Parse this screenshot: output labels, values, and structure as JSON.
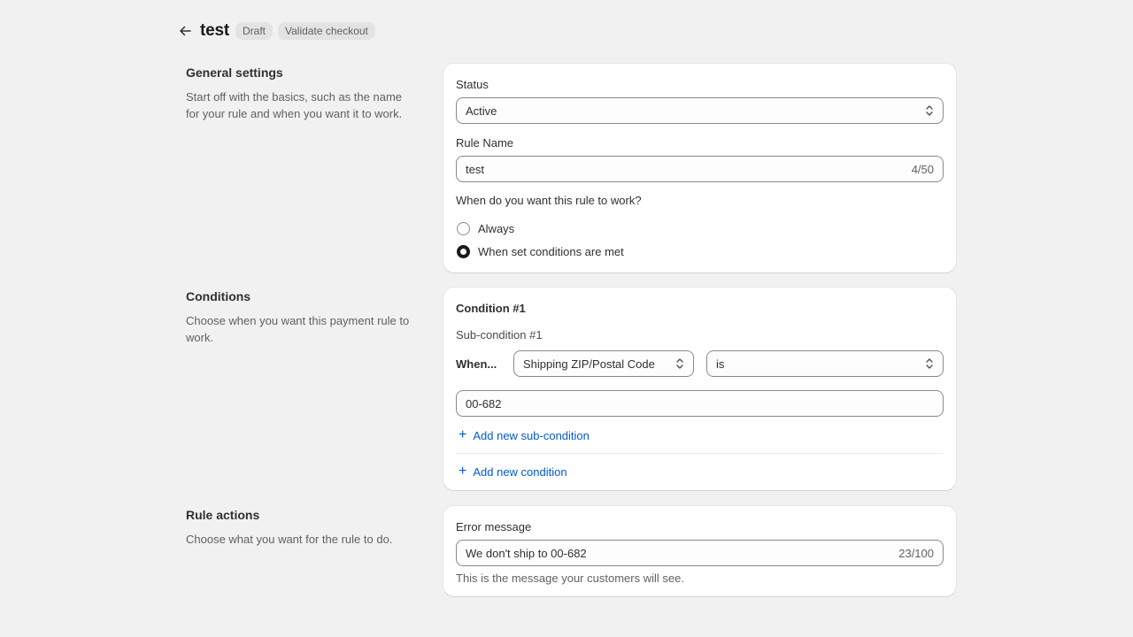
{
  "header": {
    "back_icon": "arrow-left-icon",
    "title": "test",
    "badges": [
      "Draft",
      "Validate checkout"
    ]
  },
  "general": {
    "title": "General settings",
    "description": "Start off with the basics, such as the name for your rule and when you want it to work.",
    "status_label": "Status",
    "status_value": "Active",
    "rule_name_label": "Rule Name",
    "rule_name_value": "test",
    "rule_name_counter": "4/50",
    "when_question": "When do you want this rule to work?",
    "radio_options": [
      {
        "label": "Always",
        "checked": false
      },
      {
        "label": "When set conditions are met",
        "checked": true
      }
    ]
  },
  "conditions": {
    "title": "Conditions",
    "description": "Choose when you want this payment rule to work.",
    "condition_title": "Condition #1",
    "subcondition_title": "Sub-condition #1",
    "when_label": "When...",
    "field_select": "Shipping ZIP/Postal Code",
    "operator_select": "is",
    "value": "00-682",
    "add_subcondition": "Add new sub-condition",
    "add_condition": "Add new condition"
  },
  "actions": {
    "title": "Rule actions",
    "description": "Choose what you want for the rule to do.",
    "error_label": "Error message",
    "error_value": "We don't ship to 00-682",
    "error_counter": "23/100",
    "help_text": "This is the message your customers will see."
  },
  "colors": {
    "background": "#f1f1f1",
    "link": "#005bd3",
    "badge_bg": "#e3e3e3"
  }
}
